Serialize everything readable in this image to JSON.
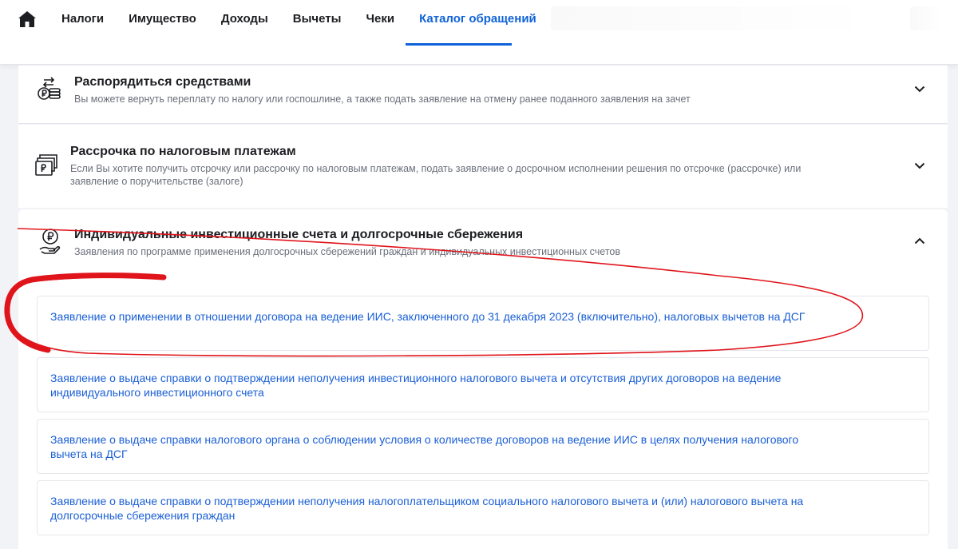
{
  "nav": {
    "items": [
      {
        "label": "Налоги",
        "active": false
      },
      {
        "label": "Имущество",
        "active": false
      },
      {
        "label": "Доходы",
        "active": false
      },
      {
        "label": "Вычеты",
        "active": false
      },
      {
        "label": "Чеки",
        "active": false
      },
      {
        "label": "Каталог обращений",
        "active": true
      }
    ],
    "accent": "#0f62d9"
  },
  "sections": [
    {
      "title": "Распорядиться средствами",
      "description": "Вы можете вернуть переплату по налогу или госпошлине, а также подать заявление на отмену ранее поданного заявления на зачет",
      "icon": "money-exchange-icon",
      "expanded": false
    },
    {
      "title": "Рассрочка по налоговым платежам",
      "description": "Если Вы хотите получить отсрочку или рассрочку по налоговым платежам, подать заявление о досрочном исполнении решения по отсрочке (рассрочке) или заявление о поручительстве (залоге)",
      "icon": "installment-card-icon",
      "expanded": false
    },
    {
      "title": "Индивидуальные инвестиционные счета и долгосрочные сбережения",
      "description": "Заявления по программе применения долгосрочных сбережений граждан и индивидуальных инвестиционных счетов",
      "icon": "ruble-hand-icon",
      "expanded": true,
      "items": [
        "Заявление о применении в отношении договора на ведение ИИС, заключенного до 31 декабря 2023 (включительно), налоговых вычетов на ДСГ",
        "Заявление о выдаче справки о подтверждении неполучения инвестиционного налогового вычета и отсутствия других договоров на ведение индивидуального инвестиционного счета",
        "Заявление о выдаче справки налогового органа о соблюдении условия о количестве договоров на ведение ИИС в целях получения налогового вычета на ДСГ",
        "Заявление о выдаче справки о подтверждении неполучения налогоплательщиком социального налогового вычета и (или) налогового вычета на долгосрочные сбережения граждан"
      ]
    }
  ],
  "colors": {
    "link": "#1a5fd6",
    "annotation": "#e0141b"
  }
}
